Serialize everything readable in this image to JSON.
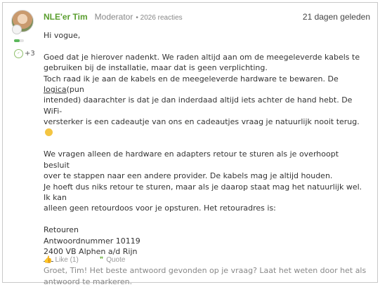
{
  "post": {
    "author": "NLE'er Tim",
    "role": "Moderator",
    "reply_count": "• 2026 reacties",
    "date": "21 dagen geleden",
    "rank_bar_level": 0.6,
    "rank_badge_count": "+3",
    "body": {
      "greeting": "Hi vogue,",
      "p1_line1": "Goed dat je hierover nadenkt. We raden altijd aan om de meegeleverde kabels te",
      "p1_line2": "gebruiken bij de installatie, maar dat is geen verplichting.",
      "p1_line3_pre": "Toch raad ik je aan de kabels en de meegeleverde hardware te bewaren. De ",
      "p1_line3_link": "logica",
      "p1_line3_post": "(pun",
      "p1_line4": "intended) daarachter is dat je dan inderdaad altijd iets achter de hand hebt. De WiFi-",
      "p1_line5": "versterker is een cadeautje van ons en cadeautjes vraag je natuurlijk nooit terug.",
      "p2_line1": "We vragen alleen de hardware en adapters retour te sturen als je overhoopt besluit",
      "p2_line2": "over te stappen naar een andere provider. De kabels mag je altijd houden.",
      "p2_line3": "Je hoeft dus niks retour te sturen, maar als je daarop staat mag het natuurlijk wel. Ik kan",
      "p2_line4": "alleen geen retourdoos voor je opsturen. Het retouradres is:",
      "addr1": "Retouren",
      "addr2": "Antwoordnummer 10119",
      "addr3": "2400 VB Alphen a/d Rijn",
      "hint_line1": "Groet, Tim! Het beste antwoord gevonden op je vraag? Laat het weten door het als",
      "hint_line2": "antwoord te markeren."
    },
    "actions": {
      "like_label": "Like (1)",
      "quote_label": "Quote"
    }
  },
  "colors": {
    "author": "#5a9e2f",
    "muted": "#888888",
    "accent": "#6db33f"
  },
  "icons": {
    "like": "thumbs-up-icon",
    "quote": "quote-icon",
    "emoji": "smiley-icon"
  }
}
